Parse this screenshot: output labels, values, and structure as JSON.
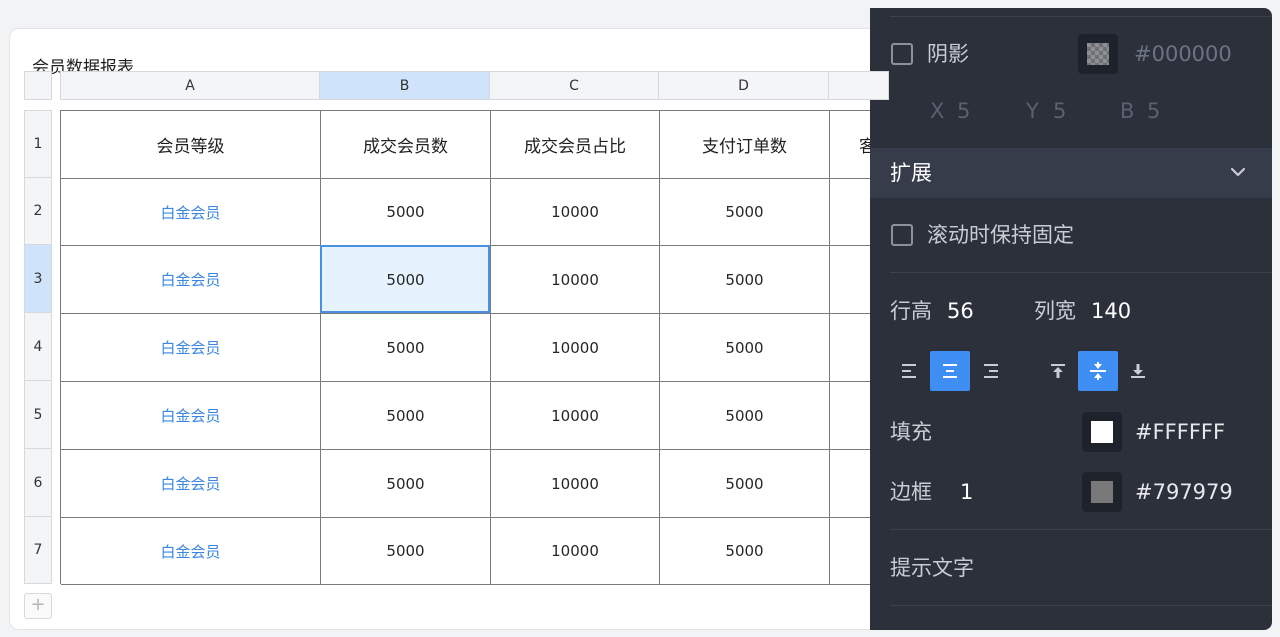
{
  "sheet": {
    "title": "会员数据报表",
    "columns": [
      "A",
      "B",
      "C",
      "D"
    ],
    "rows": [
      "1",
      "2",
      "3",
      "4",
      "5",
      "6",
      "7"
    ],
    "header_cells": [
      "会员等级",
      "成交会员数",
      "成交会员占比",
      "支付订单数",
      "客"
    ],
    "data_rows": [
      [
        "白金会员",
        "5000",
        "10000",
        "5000"
      ],
      [
        "白金会员",
        "5000",
        "10000",
        "5000"
      ],
      [
        "白金会员",
        "5000",
        "10000",
        "5000"
      ],
      [
        "白金会员",
        "5000",
        "10000",
        "5000"
      ],
      [
        "白金会员",
        "5000",
        "10000",
        "5000"
      ],
      [
        "白金会员",
        "5000",
        "10000",
        "5000"
      ]
    ],
    "selected_cell": "B3",
    "add_row_label": "+"
  },
  "panel": {
    "shadow": {
      "label": "阴影",
      "checked": false,
      "color_value": "#000000",
      "x_label": "X",
      "x_value": "5",
      "y_label": "Y",
      "y_value": "5",
      "b_label": "B",
      "b_value": "5"
    },
    "extend_section": {
      "title": "扩展",
      "sticky_label": "滚动时保持固定",
      "sticky_checked": false
    },
    "size": {
      "row_height_label": "行高",
      "row_height_value": "56",
      "col_width_label": "列宽",
      "col_width_value": "140"
    },
    "alignment": {
      "horizontal": [
        "left-align-icon",
        "center-align-icon",
        "right-align-icon"
      ],
      "horizontal_active": "center-align-icon",
      "vertical": [
        "top-align-icon",
        "middle-align-icon",
        "bottom-align-icon"
      ],
      "vertical_active": "middle-align-icon"
    },
    "fill": {
      "label": "填充",
      "color": "#FFFFFF",
      "color_value": "#FFFFFF"
    },
    "border": {
      "label": "边框",
      "width": "1",
      "color": "#797979",
      "color_value": "#797979"
    },
    "hint_text_label": "提示文字"
  },
  "colors": {
    "accent": "#3f8ef3",
    "panel_bg": "#2b303b",
    "link": "#3a86e0"
  }
}
